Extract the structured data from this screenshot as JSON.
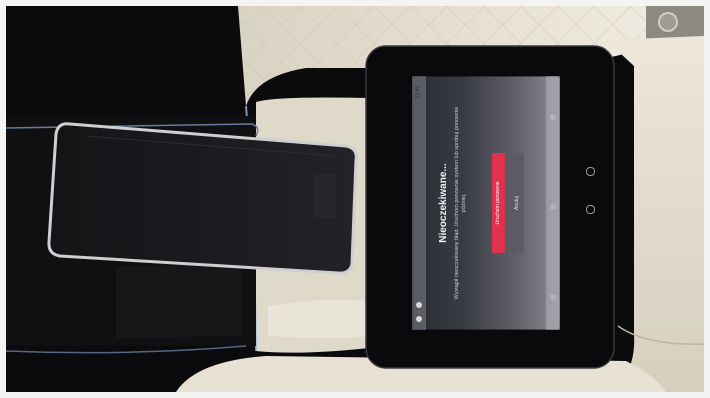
{
  "dialog": {
    "title": "Nieoczekiwane...",
    "body": "Wystąpił nieoczekiwany błąd. Uruchom ponownie system lub spróbuj ponownie później.",
    "primary_button": "Uruchom ponownie",
    "secondary_button": "Anuluj"
  },
  "status_bar": {
    "time": "12:45"
  },
  "colors": {
    "primary_button": "#e0324f",
    "secondary_button": "#5b5b63",
    "leather": "#e6e1d3",
    "console_black": "#0c0c0e"
  }
}
